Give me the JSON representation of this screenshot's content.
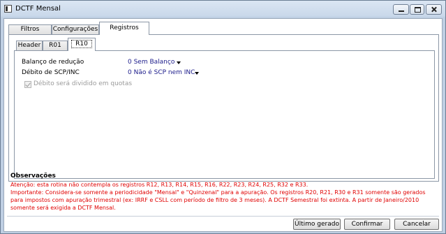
{
  "window": {
    "title": "DCTF Mensal"
  },
  "outer_tabs": [
    {
      "label": "Filtros"
    },
    {
      "label": "Configurações"
    },
    {
      "label": "Registros",
      "active": true
    }
  ],
  "inner_tabs": [
    {
      "label": "Header"
    },
    {
      "label": "R01"
    },
    {
      "label": "R10",
      "active": true
    }
  ],
  "form": {
    "balanco_label": "Balanço de redução",
    "balanco_value": "0 Sem Balanço",
    "debito_label": "Débito de SCP/INC",
    "debito_value": "0 Não é SCP nem INC",
    "quotas_label": "Débito será dividido em quotas",
    "quotas_checked": true,
    "quotas_disabled": true
  },
  "observacoes": {
    "title": "Observações",
    "lines": [
      "Atenção: esta rotina não contempla os registros R12, R13, R14, R15, R16, R22, R23, R24, R25, R32 e R33.",
      "Importante: Considera-se somente a periodicidade \"Mensal\" e \"Quinzenal\" para a apuração. Os registros R20, R21, R30 e R31 somente são gerados",
      "para impostos com apuração trimestral (ex: IRRF e CSLL com período de filtro de 3 meses). A DCTF Semestral foi extinta. A partir de Janeiro/2010",
      "somente será exigida a DCTF Mensal."
    ],
    "color": "#e00000"
  },
  "buttons": {
    "ultimo": "Último gerado",
    "confirmar": "Confirmar",
    "cancelar": "Cancelar"
  }
}
